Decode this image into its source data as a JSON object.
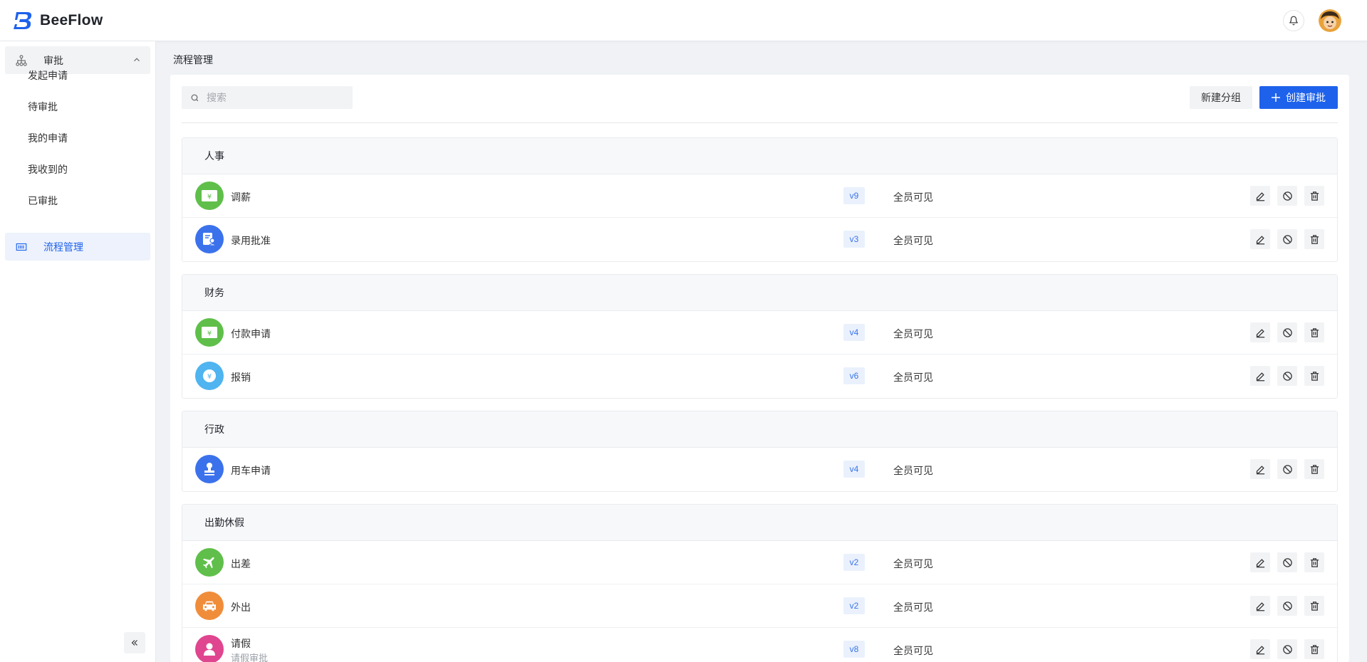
{
  "app": {
    "name": "BeeFlow"
  },
  "sidebar": {
    "group_label": "审批",
    "items": [
      {
        "label": "发起申请"
      },
      {
        "label": "待审批"
      },
      {
        "label": "我的申请"
      },
      {
        "label": "我收到的"
      },
      {
        "label": "已审批"
      }
    ],
    "active_label": "流程管理"
  },
  "main": {
    "title": "流程管理",
    "search_placeholder": "搜索",
    "new_group_label": "新建分组",
    "create_label": "创建审批",
    "groups": [
      {
        "name": "人事",
        "rows": [
          {
            "name": "调薪",
            "version": "v9",
            "scope": "全员可见",
            "icon": "yen-bill-icon",
            "color": "#5fbf4a"
          },
          {
            "name": "录用批准",
            "version": "v3",
            "scope": "全员可见",
            "icon": "hire-form-icon",
            "color": "#3b72ec"
          }
        ]
      },
      {
        "name": "财务",
        "rows": [
          {
            "name": "付款申请",
            "version": "v4",
            "scope": "全员可见",
            "icon": "yen-bill-icon",
            "color": "#5fbf4a"
          },
          {
            "name": "报销",
            "version": "v6",
            "scope": "全员可见",
            "icon": "yen-coin-icon",
            "color": "#4fb4f0"
          }
        ]
      },
      {
        "name": "行政",
        "rows": [
          {
            "name": "用车申请",
            "version": "v4",
            "scope": "全员可见",
            "icon": "stamp-icon",
            "color": "#3b72ec"
          }
        ]
      },
      {
        "name": "出勤休假",
        "rows": [
          {
            "name": "出差",
            "version": "v2",
            "scope": "全员可见",
            "icon": "plane-icon",
            "color": "#5fbf4a"
          },
          {
            "name": "外出",
            "version": "v2",
            "scope": "全员可见",
            "icon": "car-icon",
            "color": "#f08d3a"
          },
          {
            "name": "请假",
            "desc": "请假审批",
            "version": "v8",
            "scope": "全员可见",
            "icon": "person-icon",
            "color": "#e0458f"
          }
        ]
      }
    ]
  },
  "colors": {
    "primary": "#1e62ec",
    "active_bg": "#edf2fc"
  }
}
